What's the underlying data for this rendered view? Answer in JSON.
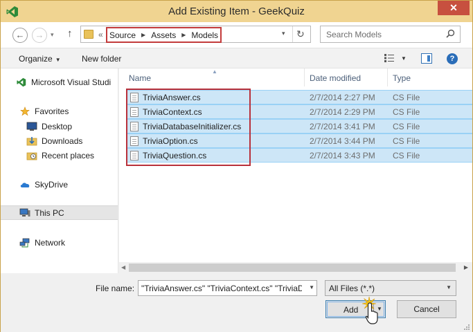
{
  "window": {
    "title": "Add Existing Item - GeekQuiz",
    "close_glyph": "✕",
    "accent": "#f0d491",
    "icon": "visual-studio-icon"
  },
  "navigation": {
    "back_glyph": "←",
    "forward_glyph": "→",
    "recent_glyph": "▾",
    "up_glyph": "↑"
  },
  "address": {
    "overflow": "«",
    "crumbs": [
      "Source",
      "Assets",
      "Models"
    ],
    "crumb_arrow": "▶",
    "dropdown_glyph": "▾",
    "refresh_glyph": "↻"
  },
  "search": {
    "placeholder": "Search Models"
  },
  "toolbar": {
    "organize": "Organize",
    "organize_caret": "▼",
    "new_folder": "New folder",
    "view_caret": "▼",
    "help": "?"
  },
  "nav_pane": {
    "items": [
      {
        "label": "Microsoft Visual Studi",
        "icon": "visual-studio-icon"
      },
      {
        "label": "Favorites",
        "icon": "star-icon"
      },
      {
        "label": "Desktop",
        "icon": "desktop-icon"
      },
      {
        "label": "Downloads",
        "icon": "downloads-icon"
      },
      {
        "label": "Recent places",
        "icon": "recent-places-icon"
      },
      {
        "label": "SkyDrive",
        "icon": "cloud-icon"
      },
      {
        "label": "This PC",
        "icon": "computer-icon",
        "selected": true
      },
      {
        "label": "Network",
        "icon": "network-icon"
      }
    ]
  },
  "file_list": {
    "columns": [
      "Name",
      "Date modified",
      "Type"
    ],
    "sort_glyph": "▲",
    "rows": [
      {
        "name": "TriviaAnswer.cs",
        "date": "2/7/2014 2:27 PM",
        "type": "CS File",
        "selected": true
      },
      {
        "name": "TriviaContext.cs",
        "date": "2/7/2014 2:29 PM",
        "type": "CS File",
        "selected": true
      },
      {
        "name": "TriviaDatabaseInitializer.cs",
        "date": "2/7/2014 3:41 PM",
        "type": "CS File",
        "selected": true
      },
      {
        "name": "TriviaOption.cs",
        "date": "2/7/2014 3:44 PM",
        "type": "CS File",
        "selected": true
      },
      {
        "name": "TriviaQuestion.cs",
        "date": "2/7/2014 3:43 PM",
        "type": "CS File",
        "selected": true
      }
    ],
    "selection_color": "#cde6f7",
    "highlight_color": "#b8303a",
    "scroll_left": "◀",
    "scroll_right": "▶"
  },
  "footer": {
    "file_name_label": "File name:",
    "file_name_value": "\"TriviaAnswer.cs\" \"TriviaContext.cs\" \"TriviaDa",
    "dropdown_glyph": "▼",
    "filter_value": "All Files (*.*)",
    "add_label": "Add",
    "add_caret": "▼",
    "cancel_label": "Cancel"
  }
}
